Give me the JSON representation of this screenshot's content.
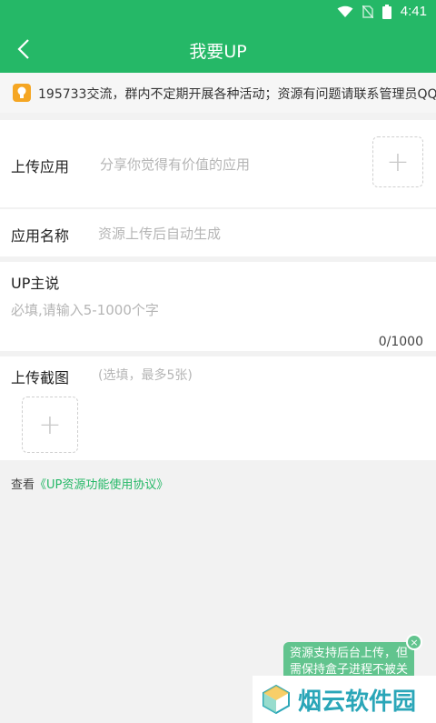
{
  "statusbar": {
    "time": "4:41"
  },
  "appbar": {
    "title": "我要UP"
  },
  "notice": {
    "text": "195733交流，群内不定期开展各种活动；资源有问题请联系管理员QQ"
  },
  "upload_app": {
    "label": "上传应用",
    "placeholder": "分享你觉得有价值的应用",
    "add_glyph": "+"
  },
  "app_name": {
    "label": "应用名称",
    "placeholder": "资源上传后自动生成"
  },
  "up_says": {
    "label": "UP主说",
    "placeholder": "必填,请输入5-1000个字",
    "counter": "0/1000"
  },
  "screenshots": {
    "label": "上传截图",
    "hint": "(选填，最多5张)",
    "add_glyph": "+"
  },
  "agreement": {
    "prefix": "查看",
    "link": "《UP资源功能使用协议》"
  },
  "tip": {
    "text": "资源支持后台上传，但需保持盒子进程不被关",
    "close_glyph": "×"
  },
  "watermark": {
    "text": "烟云软件园"
  },
  "colors": {
    "primary": "#25b867",
    "tip": "#62c48e",
    "notice_icon": "#f5a623"
  }
}
